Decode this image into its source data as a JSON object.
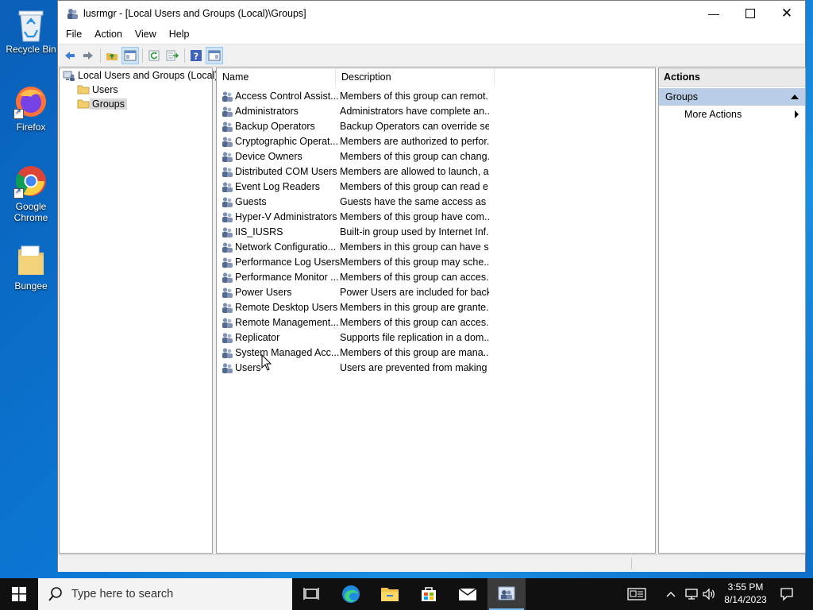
{
  "desktop": {
    "icons": [
      {
        "label": "Recycle Bin"
      },
      {
        "label": "Firefox"
      },
      {
        "label": "Google Chrome"
      },
      {
        "label": "Bungee"
      }
    ]
  },
  "window": {
    "title": "lusrmgr - [Local Users and Groups (Local)\\Groups]",
    "menu": [
      "File",
      "Action",
      "View",
      "Help"
    ],
    "toolbar": [
      "back-icon",
      "forward-icon",
      "up-folder-icon",
      "show-hide-tree-icon",
      "refresh-icon",
      "export-list-icon",
      "help-icon",
      "show-hide-action-pane-icon"
    ]
  },
  "tree": {
    "root": "Local Users and Groups (Local)",
    "items": [
      "Users",
      "Groups"
    ],
    "selected": "Groups"
  },
  "list": {
    "columns": [
      "Name",
      "Description"
    ],
    "rows": [
      {
        "name": "Access Control Assist...",
        "description": "Members of this group can remot..."
      },
      {
        "name": "Administrators",
        "description": "Administrators have complete an..."
      },
      {
        "name": "Backup Operators",
        "description": "Backup Operators can override se..."
      },
      {
        "name": "Cryptographic Operat...",
        "description": "Members are authorized to perfor..."
      },
      {
        "name": "Device Owners",
        "description": "Members of this group can chang..."
      },
      {
        "name": "Distributed COM Users",
        "description": "Members are allowed to launch, a..."
      },
      {
        "name": "Event Log Readers",
        "description": "Members of this group can read e..."
      },
      {
        "name": "Guests",
        "description": "Guests have the same access as m..."
      },
      {
        "name": "Hyper-V Administrators",
        "description": "Members of this group have com..."
      },
      {
        "name": "IIS_IUSRS",
        "description": "Built-in group used by Internet Inf..."
      },
      {
        "name": "Network Configuratio...",
        "description": "Members in this group can have s..."
      },
      {
        "name": "Performance Log Users",
        "description": "Members of this group may sche..."
      },
      {
        "name": "Performance Monitor ...",
        "description": "Members of this group can acces..."
      },
      {
        "name": "Power Users",
        "description": "Power Users are included for back..."
      },
      {
        "name": "Remote Desktop Users",
        "description": "Members in this group are grante..."
      },
      {
        "name": "Remote Management...",
        "description": "Members of this group can acces..."
      },
      {
        "name": "Replicator",
        "description": "Supports file replication in a dom..."
      },
      {
        "name": "System Managed Acc...",
        "description": "Members of this group are mana..."
      },
      {
        "name": "Users",
        "description": "Users are prevented from making ..."
      }
    ]
  },
  "actions": {
    "header": "Actions",
    "group": "Groups",
    "items": [
      "More Actions"
    ]
  },
  "taskbar": {
    "search_placeholder": "Type here to search",
    "time": "3:55 PM",
    "date": "8/14/2023"
  },
  "colors": {
    "desktop": "#0b78d4",
    "selection": "#b9cde6",
    "taskbar": "#101010"
  }
}
